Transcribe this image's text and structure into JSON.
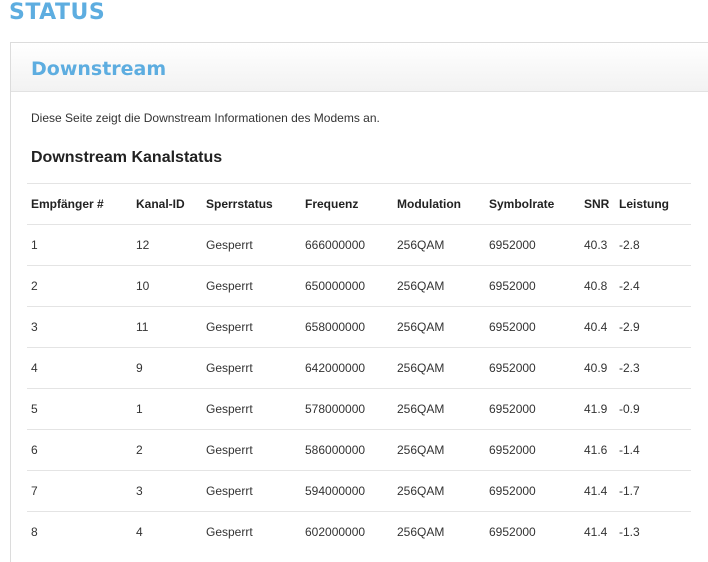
{
  "page": {
    "title": "STATUS"
  },
  "panel": {
    "title": "Downstream",
    "description": "Diese Seite zeigt die Downstream Informationen des Modems an.",
    "section_title": "Downstream Kanalstatus"
  },
  "table": {
    "headers": [
      "Empfänger #",
      "Kanal-ID",
      "Sperrstatus",
      "Frequenz",
      "Modulation",
      "Symbolrate",
      "SNR",
      "Leistung"
    ],
    "rows": [
      [
        "1",
        "12",
        "Gesperrt",
        "666000000",
        "256QAM",
        "6952000",
        "40.3",
        "-2.8"
      ],
      [
        "2",
        "10",
        "Gesperrt",
        "650000000",
        "256QAM",
        "6952000",
        "40.8",
        "-2.4"
      ],
      [
        "3",
        "11",
        "Gesperrt",
        "658000000",
        "256QAM",
        "6952000",
        "40.4",
        "-2.9"
      ],
      [
        "4",
        "9",
        "Gesperrt",
        "642000000",
        "256QAM",
        "6952000",
        "40.9",
        "-2.3"
      ],
      [
        "5",
        "1",
        "Gesperrt",
        "578000000",
        "256QAM",
        "6952000",
        "41.9",
        "-0.9"
      ],
      [
        "6",
        "2",
        "Gesperrt",
        "586000000",
        "256QAM",
        "6952000",
        "41.6",
        "-1.4"
      ],
      [
        "7",
        "3",
        "Gesperrt",
        "594000000",
        "256QAM",
        "6952000",
        "41.4",
        "-1.7"
      ],
      [
        "8",
        "4",
        "Gesperrt",
        "602000000",
        "256QAM",
        "6952000",
        "41.4",
        "-1.3"
      ]
    ]
  },
  "colors": {
    "accent": "#5dade0",
    "text": "#333333",
    "divider": "#e4e4e4"
  }
}
